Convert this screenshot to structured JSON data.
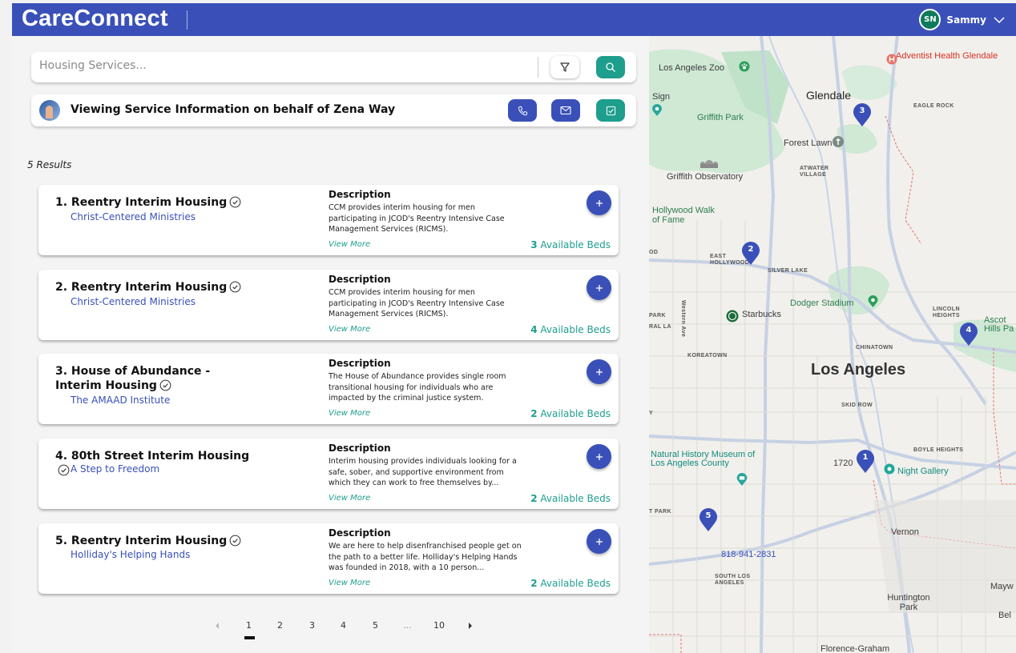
{
  "header": {
    "brand": "CareConnect",
    "user_initials": "SN",
    "user_name": "Sammy"
  },
  "search": {
    "placeholder": "Housing Services..."
  },
  "client_bar": {
    "text": "Viewing Service Information on behalf of Zena Way"
  },
  "results_count": "5 Results",
  "results": [
    {
      "title": "1. Reentry Interim Housing",
      "org": "Christ-Centered Ministries",
      "desc_heading": "Description",
      "desc": "CCM provides interim housing for men participating in JCOD's Reentry Intensive Case Management Services (RICMS).",
      "view_more": "View More",
      "beds_count": "3",
      "beds_label": "Available Beds"
    },
    {
      "title": "2. Reentry Interim Housing",
      "org": "Christ-Centered Ministries",
      "desc_heading": "Description",
      "desc": "CCM provides interim housing for men participating in JCOD's Reentry Intensive Case Management Services (RICMS).",
      "view_more": "View More",
      "beds_count": "4",
      "beds_label": "Available Beds"
    },
    {
      "title": "3. House of Abundance - Interim Housing",
      "org": "The AMAAD Institute",
      "desc_heading": "Description",
      "desc": "The House of Abundance provides single room transitional housing for individuals who are impacted by the criminal justice system.",
      "view_more": "View More",
      "beds_count": "2",
      "beds_label": "Available Beds"
    },
    {
      "title": "4. 80th Street Interim Housing",
      "org": "A Step to Freedom",
      "desc_heading": "Description",
      "desc": "Interim housing provides individuals looking for a safe, sober, and supportive environment from which they can work to free themselves by...",
      "view_more": "View More",
      "beds_count": "2",
      "beds_label": "Available Beds"
    },
    {
      "title": "5. Reentry Interim Housing",
      "org": "Holliday's Helping Hands",
      "desc_heading": "Description",
      "desc": "We are here to help disenfranchised people get on the path to a better life. Holliday's Helping Hands was founded in 2018, with a 10 person...",
      "view_more": "View More",
      "beds_count": "2",
      "beds_label": "Available Beds"
    }
  ],
  "pagination": {
    "pages": [
      "1",
      "2",
      "3",
      "4",
      "5",
      "...",
      "10"
    ],
    "current": "1"
  },
  "map": {
    "labels": {
      "zoo": "Los Angeles Zoo",
      "adventist": "Adventist Health Glendale",
      "glendale": "Glendale",
      "eagle_rock": "EAGLE ROCK",
      "sign": "Sign",
      "griffith_park": "Griffith Park",
      "forest_lawn": "Forest Lawn",
      "atwater": "ATWATER VILLAGE",
      "observatory": "Griffith Observatory",
      "hollywood_walk": "Hollywood Walk of Fame",
      "east_hollywood": "EAST HOLLYWOOD",
      "silver_lake": "SILVER LAKE",
      "western_ave": "Western Ave",
      "dodger": "Dodger Stadium",
      "starbucks": "Starbucks",
      "lincoln_heights": "LINCOLN HEIGHTS",
      "ascot": "Ascot Hills Pa",
      "koreatown": "KOREATOWN",
      "chinatown": "CHINATOWN",
      "los_angeles": "Los Angeles",
      "skid_row": "SKID ROW",
      "natural_history": "Natural History Museum of Los Angeles County",
      "boyle_heights": "BOYLE HEIGHTS",
      "num_1720": "1720",
      "night_gallery": "Night Gallery",
      "park_fragment": "PARK",
      "ral_la": "RAL LA",
      "od": "OD",
      "y": "Y",
      "t_park": "T PARK",
      "vernon": "Vernon",
      "phone": "818-941-2831",
      "south_los_angeles": "SOUTH LOS ANGELES",
      "huntington_park": "Huntington Park",
      "mayw": "Mayw",
      "bel": "Bel",
      "florence": "Florence-Graham"
    },
    "pins": [
      "1",
      "2",
      "3",
      "4",
      "5"
    ]
  }
}
